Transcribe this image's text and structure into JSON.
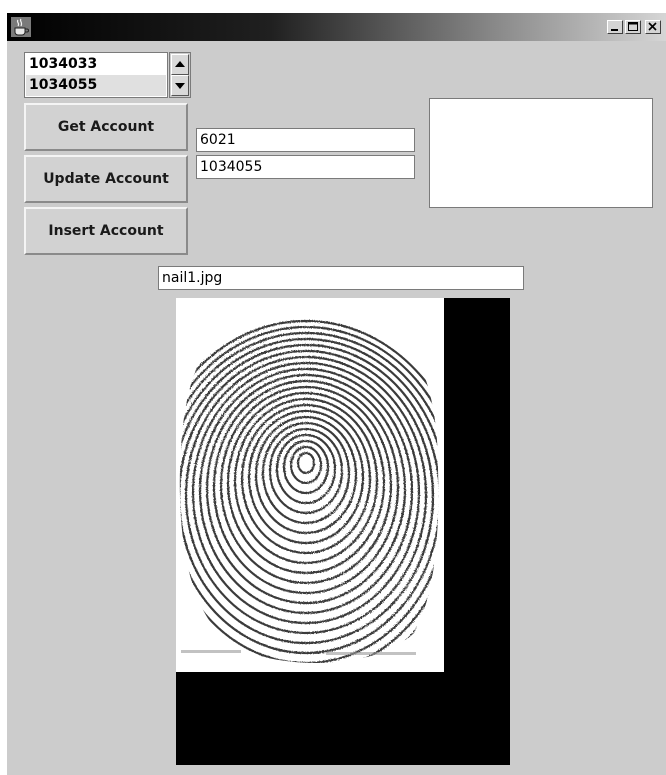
{
  "window": {
    "title": "",
    "controls": {
      "minimize": "minimize-icon",
      "maximize": "maximize-icon",
      "close": "close-icon"
    }
  },
  "account_list": {
    "items": [
      "1034033",
      "1034055"
    ],
    "selected_index": 1
  },
  "buttons": {
    "get": "Get Account",
    "update": "Update Account",
    "insert": "Insert Account"
  },
  "fields": {
    "field1": "6021",
    "field2": "1034055",
    "image_file": "nail1.jpg",
    "notes": ""
  },
  "image": {
    "description_icon": "fingerprint-image"
  },
  "colors": {
    "window_bg": "#cccccc",
    "titlebar_dark": "#000000",
    "titlebar_light": "#d6d6d6"
  }
}
